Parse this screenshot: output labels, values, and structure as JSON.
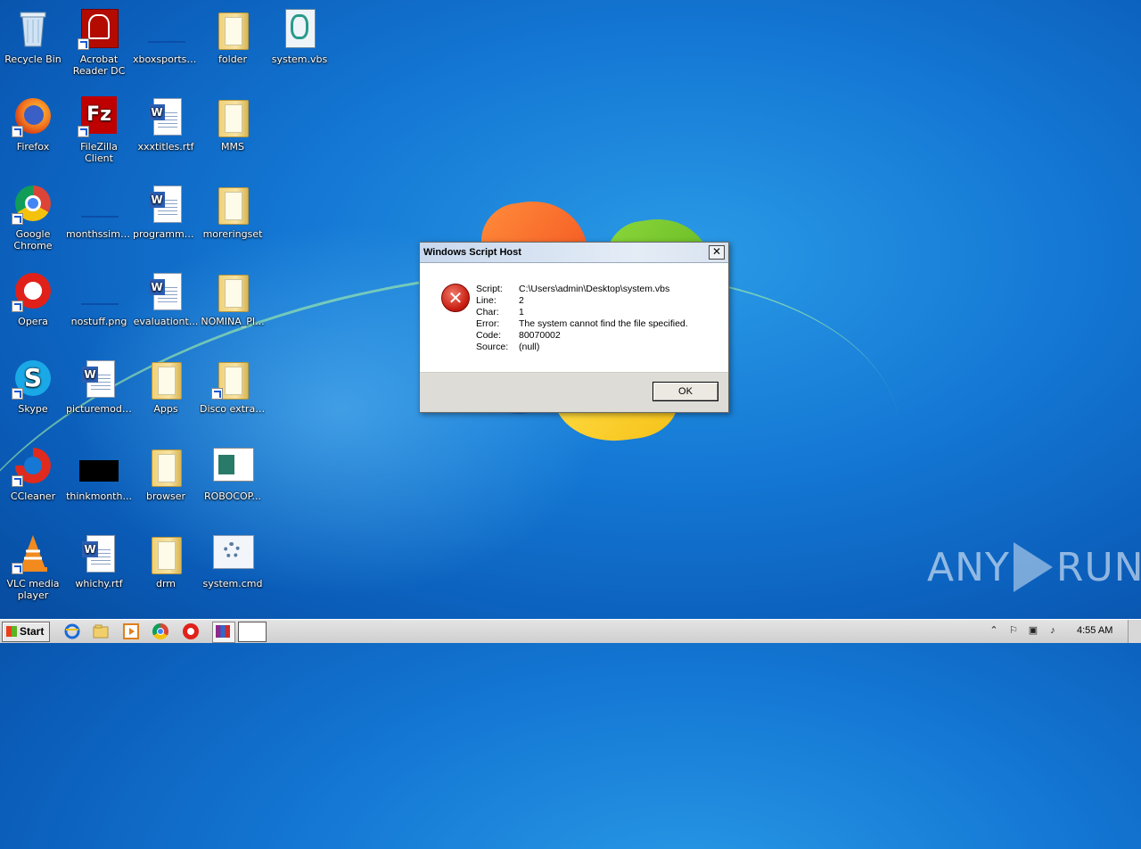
{
  "desktop": {
    "icons": [
      {
        "label": "Recycle Bin"
      },
      {
        "label": "Acrobat Reader DC"
      },
      {
        "label": "xboxsports...."
      },
      {
        "label": "folder"
      },
      {
        "label": "system.vbs"
      },
      {
        "label": "Firefox"
      },
      {
        "label": "FileZilla Client"
      },
      {
        "label": "xxxtitles.rtf"
      },
      {
        "label": "MMS"
      },
      {
        "label": "Google Chrome"
      },
      {
        "label": "monthssimp..."
      },
      {
        "label": "programme..."
      },
      {
        "label": "moreringset"
      },
      {
        "label": "Opera"
      },
      {
        "label": "nostuff.png"
      },
      {
        "label": "evaluationt..."
      },
      {
        "label": "NOMINA_PI..."
      },
      {
        "label": "Skype"
      },
      {
        "label": "picturemodi..."
      },
      {
        "label": "Apps"
      },
      {
        "label": "Disco extraible"
      },
      {
        "label": "CCleaner"
      },
      {
        "label": "thinkmonth..."
      },
      {
        "label": "browser"
      },
      {
        "label": "ROBOCOP..."
      },
      {
        "label": "VLC media player"
      },
      {
        "label": "whichy.rtf"
      },
      {
        "label": "drm"
      },
      {
        "label": "system.cmd"
      }
    ]
  },
  "dialog": {
    "title": "Windows Script Host",
    "close_glyph": "✕",
    "error_glyph": "✕",
    "rows": [
      {
        "key": "Script:",
        "value": "C:\\Users\\admin\\Desktop\\system.vbs"
      },
      {
        "key": "Line:",
        "value": "2"
      },
      {
        "key": "Char:",
        "value": "1"
      },
      {
        "key": "Error:",
        "value": "The system cannot find the file specified."
      },
      {
        "key": "Code:",
        "value": "80070002"
      },
      {
        "key": "Source:",
        "value": "(null)"
      }
    ],
    "ok_label": "OK"
  },
  "watermark": {
    "left": "ANY",
    "right": "RUN"
  },
  "taskbar": {
    "start_label": "Start",
    "clock": "4:55 AM"
  },
  "colors": {
    "desktop_bg": "#1478d4",
    "error_red": "#c81e12"
  }
}
